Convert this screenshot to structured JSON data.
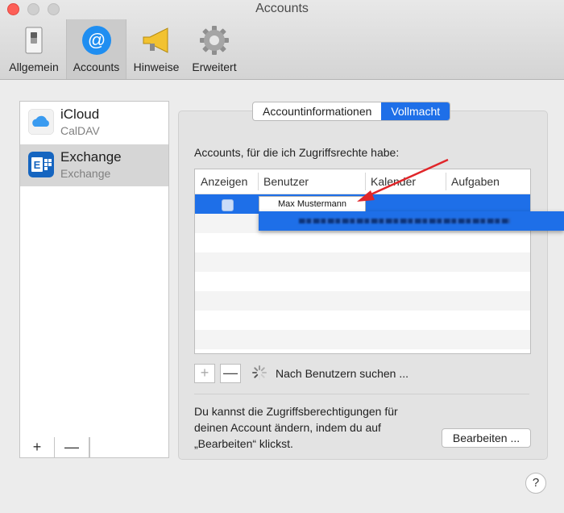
{
  "window": {
    "title": "Accounts"
  },
  "toolbar": {
    "items": [
      {
        "label": "Allgemein",
        "icon": "switch-icon"
      },
      {
        "label": "Accounts",
        "icon": "at-icon"
      },
      {
        "label": "Hinweise",
        "icon": "megaphone-icon"
      },
      {
        "label": "Erweitert",
        "icon": "gear-icon"
      }
    ],
    "active": "Accounts"
  },
  "accounts": [
    {
      "name": "iCloud",
      "type": "CalDAV",
      "icon": "icloud-icon",
      "selected": false
    },
    {
      "name": "Exchange",
      "type": "Exchange",
      "icon": "exchange-icon",
      "selected": true
    }
  ],
  "list_tools": {
    "add": "+",
    "remove": "—"
  },
  "tabs": [
    {
      "label": "Accountinformationen",
      "active": false
    },
    {
      "label": "Vollmacht",
      "active": true
    }
  ],
  "delegation": {
    "label": "Accounts, für die ich Zugriffsrechte habe:",
    "columns": [
      "Anzeigen",
      "Benutzer",
      "Kalender",
      "Aufgaben"
    ],
    "popup_name": "Max Mustermann",
    "add_button": "+",
    "remove_button": "—",
    "search_status": "Nach Benutzern suchen ..."
  },
  "description": {
    "lines": [
      "Du kannst die Zugriffsberechtigungen für",
      "deinen Account ändern, indem du auf",
      "„Bearbeiten“ klickst."
    ]
  },
  "buttons": {
    "edit": "Bearbeiten ...",
    "help": "?"
  },
  "colors": {
    "accent": "#1e6fe8",
    "annotation_arrow": "#e0262a"
  }
}
